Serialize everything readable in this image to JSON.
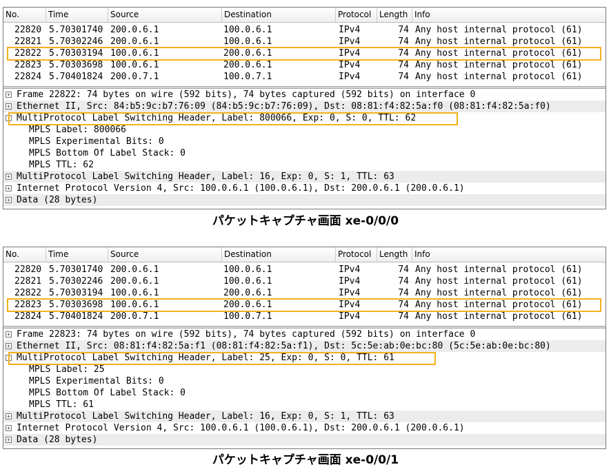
{
  "columns": {
    "no": "No.",
    "time": "Time",
    "source": "Source",
    "destination": "Destination",
    "protocol": "Protocol",
    "length": "Length",
    "info": "Info"
  },
  "panels": [
    {
      "packets": [
        {
          "no": "22820",
          "time": "5.70301740",
          "source": "200.0.6.1",
          "destination": "100.0.6.1",
          "protocol": "IPv4",
          "length": "74",
          "info": "Any host internal protocol (61)"
        },
        {
          "no": "22821",
          "time": "5.70302246",
          "source": "200.0.6.1",
          "destination": "100.0.6.1",
          "protocol": "IPv4",
          "length": "74",
          "info": "Any host internal protocol (61)"
        },
        {
          "no": "22822",
          "time": "5.70303194",
          "source": "100.0.6.1",
          "destination": "200.0.6.1",
          "protocol": "IPv4",
          "length": "74",
          "info": "Any host internal protocol (61)"
        },
        {
          "no": "22823",
          "time": "5.70303698",
          "source": "100.0.6.1",
          "destination": "200.0.6.1",
          "protocol": "IPv4",
          "length": "74",
          "info": "Any host internal protocol (61)"
        },
        {
          "no": "22824",
          "time": "5.70401824",
          "source": "200.0.7.1",
          "destination": "100.0.7.1",
          "protocol": "IPv4",
          "length": "74",
          "info": "Any host internal protocol (61)"
        }
      ],
      "details": [
        {
          "text": "Frame 22822: 74 bytes on wire (592 bits), 74 bytes captured (592 bits) on interface 0",
          "expander": "+"
        },
        {
          "text": "Ethernet II, Src: 84:b5:9c:b7:76:09 (84:b5:9c:b7:76:09), Dst: 08:81:f4:82:5a:f0 (08:81:f4:82:5a:f0)",
          "expander": "+"
        },
        {
          "text": "MultiProtocol Label Switching Header, Label: 800066, Exp: 0, S: 0, TTL: 62",
          "expander": "-"
        },
        {
          "text": "MPLS Label: 800066"
        },
        {
          "text": "MPLS Experimental Bits: 0"
        },
        {
          "text": "MPLS Bottom Of Label Stack: 0"
        },
        {
          "text": "MPLS TTL: 62"
        },
        {
          "text": "MultiProtocol Label Switching Header, Label: 16, Exp: 0, S: 1, TTL: 63",
          "expander": "+"
        },
        {
          "text": "Internet Protocol Version 4, Src: 100.0.6.1 (100.0.6.1), Dst: 200.0.6.1 (200.0.6.1)",
          "expander": "+"
        },
        {
          "text": "Data (28 bytes)",
          "expander": "+"
        }
      ],
      "caption": "パケットキャプチャ画面 xe-0/0/0"
    },
    {
      "packets": [
        {
          "no": "22820",
          "time": "5.70301740",
          "source": "200.0.6.1",
          "destination": "100.0.6.1",
          "protocol": "IPv4",
          "length": "74",
          "info": "Any host internal protocol (61)"
        },
        {
          "no": "22821",
          "time": "5.70302246",
          "source": "200.0.6.1",
          "destination": "100.0.6.1",
          "protocol": "IPv4",
          "length": "74",
          "info": "Any host internal protocol (61)"
        },
        {
          "no": "22822",
          "time": "5.70303194",
          "source": "100.0.6.1",
          "destination": "200.0.6.1",
          "protocol": "IPv4",
          "length": "74",
          "info": "Any host internal protocol (61)"
        },
        {
          "no": "22823",
          "time": "5.70303698",
          "source": "100.0.6.1",
          "destination": "200.0.6.1",
          "protocol": "IPv4",
          "length": "74",
          "info": "Any host internal protocol (61)"
        },
        {
          "no": "22824",
          "time": "5.70401824",
          "source": "200.0.7.1",
          "destination": "100.0.7.1",
          "protocol": "IPv4",
          "length": "74",
          "info": "Any host internal protocol (61)"
        }
      ],
      "details": [
        {
          "text": "Frame 22823: 74 bytes on wire (592 bits), 74 bytes captured (592 bits) on interface 0",
          "expander": "+"
        },
        {
          "text": "Ethernet II, Src: 08:81:f4:82:5a:f1 (08:81:f4:82:5a:f1), Dst: 5c:5e:ab:0e:bc:80 (5c:5e:ab:0e:bc:80)",
          "expander": "+"
        },
        {
          "text": "MultiProtocol Label Switching Header, Label: 25, Exp: 0, S: 0, TTL: 61",
          "expander": "-"
        },
        {
          "text": "MPLS Label: 25"
        },
        {
          "text": "MPLS Experimental Bits: 0"
        },
        {
          "text": "MPLS Bottom Of Label Stack: 0"
        },
        {
          "text": "MPLS TTL: 61"
        },
        {
          "text": "MultiProtocol Label Switching Header, Label: 16, Exp: 0, S: 1, TTL: 63",
          "expander": "+"
        },
        {
          "text": "Internet Protocol Version 4, Src: 100.0.6.1 (100.0.6.1), Dst: 200.0.6.1 (200.0.6.1)",
          "expander": "+"
        },
        {
          "text": "Data (28 bytes)",
          "expander": "+"
        }
      ],
      "caption": "パケットキャプチャ画面 xe-0/0/1"
    }
  ],
  "highlight_color": "#f5b11a"
}
